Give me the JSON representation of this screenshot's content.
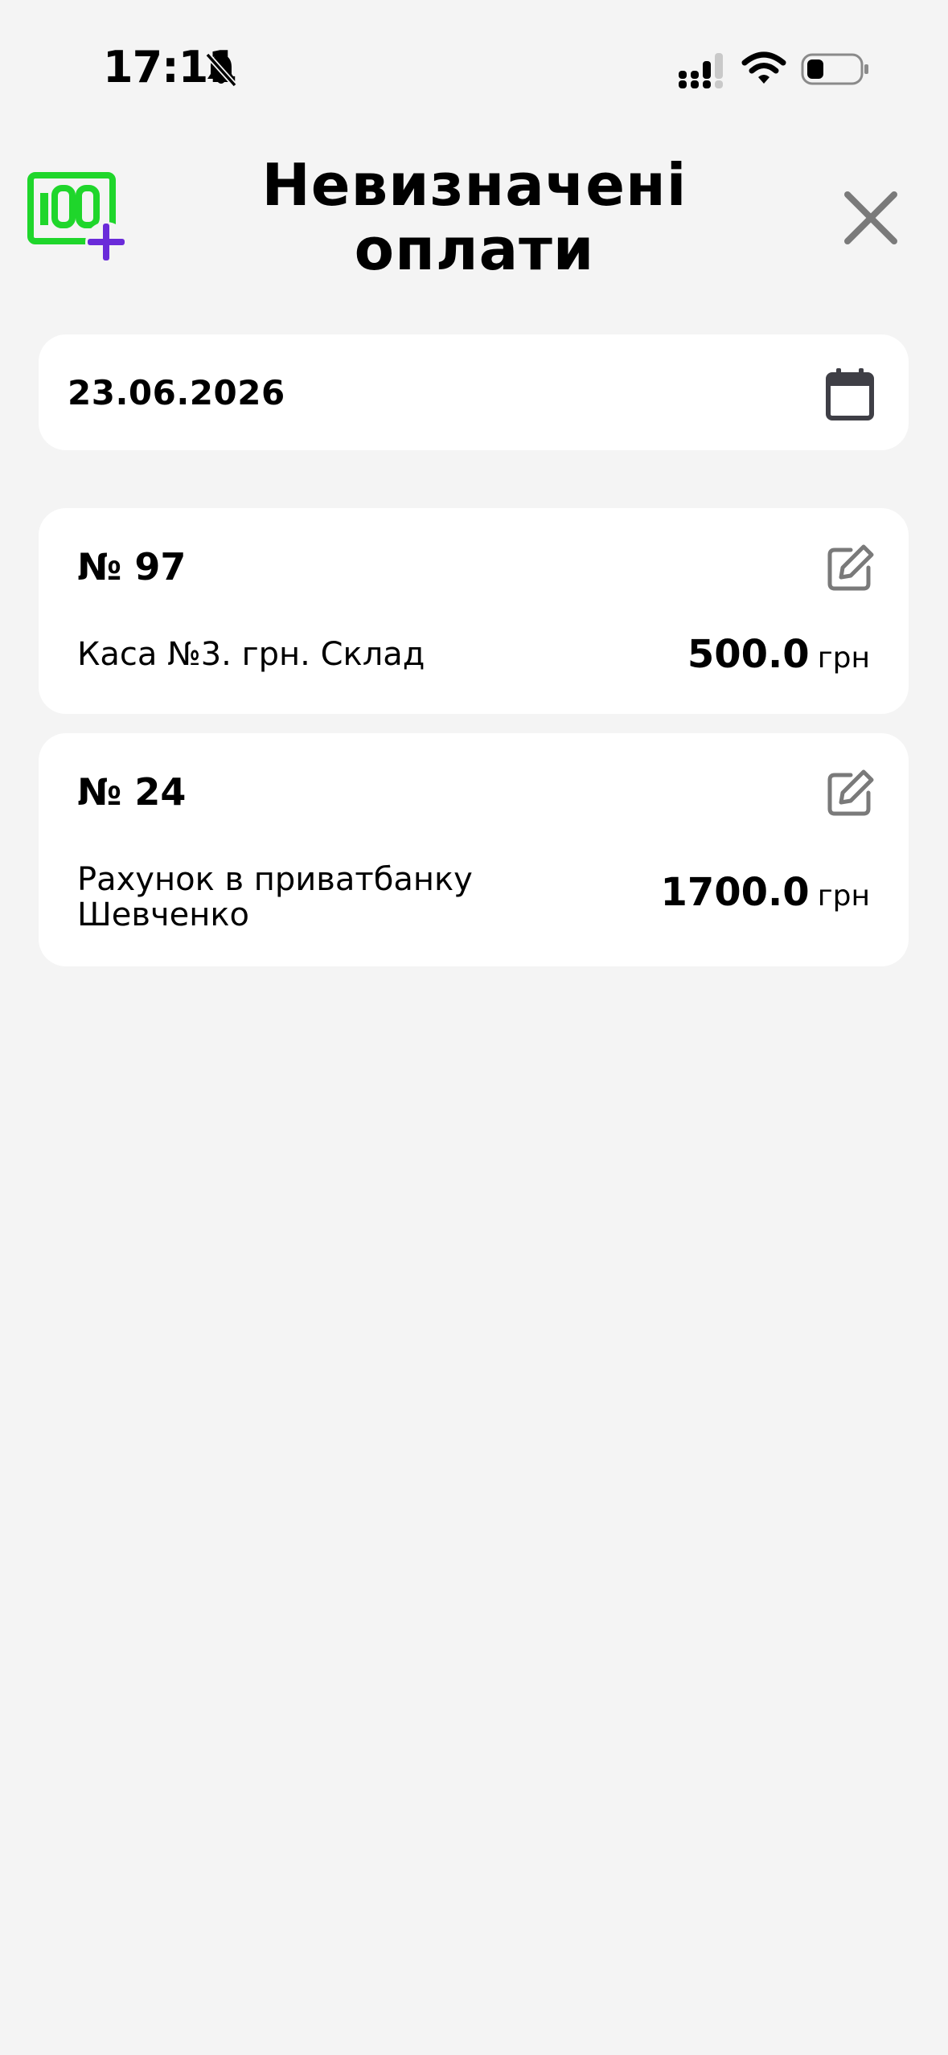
{
  "status_bar": {
    "time": "17:11"
  },
  "header": {
    "title_line1": "Невизначені",
    "title_line2": "оплати"
  },
  "date_field": {
    "value": "23.06.2026"
  },
  "payments": [
    {
      "number": "№ 97",
      "account": "Каса №3. грн. Склад",
      "amount": "500.0",
      "currency": "грн"
    },
    {
      "number": "№ 24",
      "account": "Рахунок в приватбанку Шевченко",
      "amount": "1700.0",
      "currency": "грн"
    }
  ],
  "colors": {
    "background": "#f4f4f4",
    "card": "#ffffff",
    "logo_green": "#1fd62b",
    "logo_plus": "#6a2bd9",
    "icon_gray": "#7a7a7a",
    "calendar_dark": "#3f3f46"
  },
  "icons": {
    "logo": "logo-icon",
    "close": "close-icon",
    "calendar": "calendar-icon",
    "edit": "edit-icon",
    "bell_muted": "bell-slash-icon",
    "signal": "signal-icon",
    "wifi": "wifi-icon",
    "battery": "battery-icon"
  }
}
